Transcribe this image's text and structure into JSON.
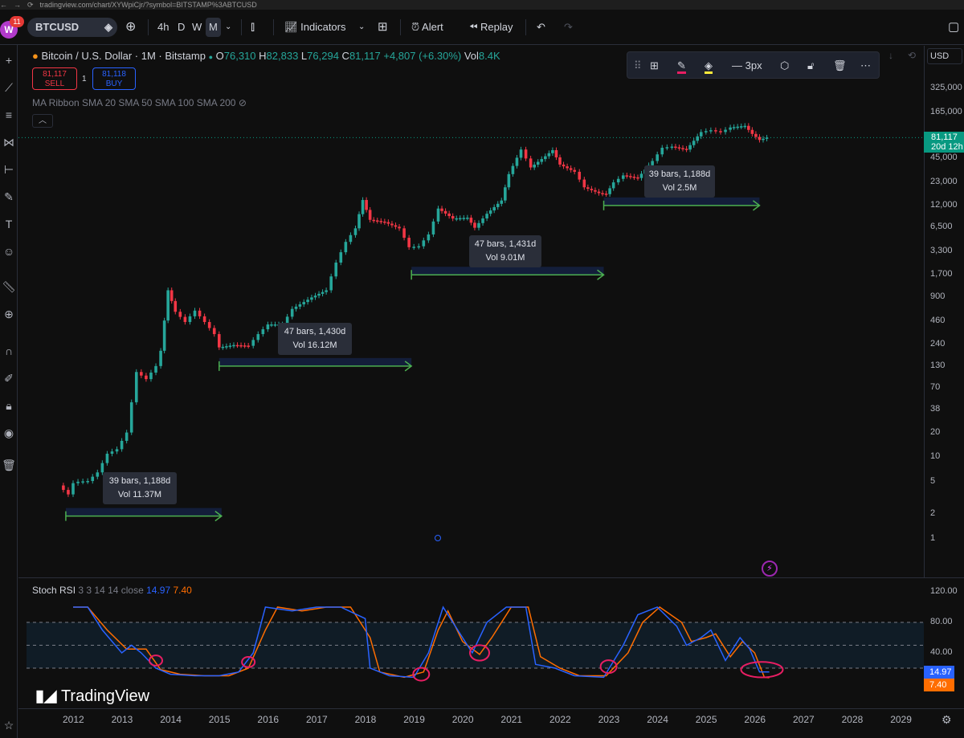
{
  "browser": {
    "url": "tradingview.com/chart/XYWpiCjr/?symbol=BITSTAMP%3ABTCUSD"
  },
  "toolbar": {
    "avatar_letter": "W",
    "notification_count": "11",
    "symbol": "BTCUSD",
    "timeframes": [
      "4h",
      "D",
      "W",
      "M"
    ],
    "active_timeframe": "M",
    "indicators_label": "Indicators",
    "alert_label": "Alert",
    "replay_label": "Replay"
  },
  "legend": {
    "title": "Bitcoin / U.S. Dollar · 1M · Bitstamp",
    "open_label": "O",
    "open": "76,310",
    "high_label": "H",
    "high": "82,833",
    "low_label": "L",
    "low": "76,294",
    "close_label": "C",
    "close": "81,117",
    "change": "+4,807 (+6.30%)",
    "vol_label": "Vol",
    "vol": "8.4K"
  },
  "trade": {
    "sell_price": "81,117",
    "sell_label": "SELL",
    "qty": "1",
    "buy_price": "81,118",
    "buy_label": "BUY"
  },
  "ma_ribbon_label": "MA Ribbon SMA 20 SMA 50 SMA 100 SMA 200",
  "draw_toolbar": {
    "width_label": "3px"
  },
  "price_axis": {
    "currency": "USD",
    "ticks": [
      "325,000",
      "165,000",
      "45,000",
      "23,000",
      "12,000",
      "6,500",
      "3,300",
      "1,700",
      "900",
      "460",
      "240",
      "130",
      "70",
      "38",
      "20",
      "10",
      "5",
      "2",
      "1"
    ],
    "last_price": "81,117",
    "countdown": "20d 12h"
  },
  "annotations": [
    {
      "bars": "39 bars, 1,188d",
      "vol": "Vol 11.37M"
    },
    {
      "bars": "47 bars, 1,430d",
      "vol": "Vol 16.12M"
    },
    {
      "bars": "47 bars, 1,431d",
      "vol": "Vol 9.01M"
    },
    {
      "bars": "39 bars, 1,188d",
      "vol": "Vol 2.5M"
    }
  ],
  "stoch": {
    "label": "Stoch RSI",
    "params": "3 3 14 14 close",
    "k_value": "14.97",
    "d_value": "7.40",
    "ticks": [
      "120.00",
      "80.00",
      "40.00"
    ],
    "k_color": "#2962ff",
    "d_color": "#ff6d00"
  },
  "time_axis": {
    "ticks": [
      "2012",
      "2013",
      "2014",
      "2015",
      "2016",
      "2017",
      "2018",
      "2019",
      "2020",
      "2021",
      "2022",
      "2023",
      "2024",
      "2025",
      "2026",
      "2027",
      "2028",
      "2029"
    ]
  },
  "brand": "TradingView",
  "chart_data": {
    "type": "candlestick",
    "title": "Bitcoin / U.S. Dollar · 1M · Bitstamp",
    "scale": "log",
    "ylim": [
      1,
      325000
    ],
    "x_start_year": 2012,
    "series": [
      {
        "name": "BTCUSD",
        "close": [
          [
            2011.7,
            4.5
          ],
          [
            2011.9,
            3.5
          ],
          [
            2012.0,
            4.8
          ],
          [
            2012.1,
            5.0
          ],
          [
            2012.3,
            5.1
          ],
          [
            2012.5,
            6.5
          ],
          [
            2012.7,
            11
          ],
          [
            2012.9,
            12.5
          ],
          [
            2013.1,
            20
          ],
          [
            2013.3,
            110
          ],
          [
            2013.5,
            90
          ],
          [
            2013.7,
            130
          ],
          [
            2013.8,
            200
          ],
          [
            2013.95,
            1100
          ],
          [
            2014.1,
            600
          ],
          [
            2014.3,
            450
          ],
          [
            2014.5,
            620
          ],
          [
            2014.7,
            450
          ],
          [
            2014.9,
            320
          ],
          [
            2015.0,
            220
          ],
          [
            2015.3,
            235
          ],
          [
            2015.6,
            230
          ],
          [
            2015.8,
            320
          ],
          [
            2016.0,
            420
          ],
          [
            2016.3,
            420
          ],
          [
            2016.5,
            650
          ],
          [
            2016.9,
            900
          ],
          [
            2017.2,
            1100
          ],
          [
            2017.4,
            2400
          ],
          [
            2017.6,
            4300
          ],
          [
            2017.8,
            6300
          ],
          [
            2017.95,
            14000
          ],
          [
            2018.1,
            8000
          ],
          [
            2018.4,
            7500
          ],
          [
            2018.7,
            6300
          ],
          [
            2018.9,
            3700
          ],
          [
            2019.1,
            3800
          ],
          [
            2019.3,
            5300
          ],
          [
            2019.5,
            11000
          ],
          [
            2019.8,
            8300
          ],
          [
            2020.1,
            8500
          ],
          [
            2020.25,
            6400
          ],
          [
            2020.5,
            9500
          ],
          [
            2020.8,
            13800
          ],
          [
            2020.95,
            29000
          ],
          [
            2021.2,
            58000
          ],
          [
            2021.4,
            35000
          ],
          [
            2021.7,
            48000
          ],
          [
            2021.85,
            57000
          ],
          [
            2022.0,
            38000
          ],
          [
            2022.3,
            31000
          ],
          [
            2022.5,
            20000
          ],
          [
            2022.8,
            17000
          ],
          [
            2022.95,
            16500
          ],
          [
            2023.1,
            23000
          ],
          [
            2023.3,
            28000
          ],
          [
            2023.6,
            26000
          ],
          [
            2023.9,
            42000
          ],
          [
            2024.1,
            61000
          ],
          [
            2024.3,
            63000
          ],
          [
            2024.6,
            58000
          ],
          [
            2024.9,
            95000
          ],
          [
            2025.1,
            100000
          ],
          [
            2025.3,
            95000
          ],
          [
            2025.5,
            108000
          ],
          [
            2025.8,
            113000
          ],
          [
            2025.95,
            90000
          ],
          [
            2026.1,
            76000
          ],
          [
            2026.25,
            81117
          ]
        ]
      }
    ],
    "measures": [
      {
        "label": "39 bars, 1,188d",
        "vol": "Vol 11.37M",
        "from": 2011.85,
        "to": 2015.05,
        "price": 1.9
      },
      {
        "label": "47 bars, 1,430d",
        "vol": "Vol 16.12M",
        "from": 2015.0,
        "to": 2018.95,
        "price": 130
      },
      {
        "label": "47 bars, 1,431d",
        "vol": "Vol 9.01M",
        "from": 2018.95,
        "to": 2022.9,
        "price": 1700
      },
      {
        "label": "39 bars, 1,188d",
        "vol": "Vol 2.5M",
        "from": 2022.9,
        "to": 2026.1,
        "price": 12000
      }
    ],
    "stoch_rsi": {
      "ylim": [
        0,
        120
      ],
      "bands": [
        20,
        80
      ],
      "k": [
        [
          2012.0,
          100
        ],
        [
          2012.3,
          100
        ],
        [
          2012.6,
          70
        ],
        [
          2013.0,
          40
        ],
        [
          2013.2,
          50
        ],
        [
          2013.4,
          40
        ],
        [
          2013.7,
          20
        ],
        [
          2014.0,
          12
        ],
        [
          2014.5,
          10
        ],
        [
          2015.0,
          10
        ],
        [
          2015.4,
          15
        ],
        [
          2015.7,
          40
        ],
        [
          2015.95,
          100
        ],
        [
          2016.5,
          95
        ],
        [
          2017.0,
          100
        ],
        [
          2017.5,
          100
        ],
        [
          2018.0,
          85
        ],
        [
          2018.1,
          20
        ],
        [
          2018.5,
          10
        ],
        [
          2019.0,
          8
        ],
        [
          2019.3,
          40
        ],
        [
          2019.6,
          100
        ],
        [
          2019.8,
          80
        ],
        [
          2020.2,
          40
        ],
        [
          2020.5,
          80
        ],
        [
          2020.9,
          100
        ],
        [
          2021.3,
          100
        ],
        [
          2021.5,
          25
        ],
        [
          2021.9,
          20
        ],
        [
          2022.3,
          10
        ],
        [
          2022.9,
          8
        ],
        [
          2023.3,
          50
        ],
        [
          2023.6,
          90
        ],
        [
          2024.0,
          100
        ],
        [
          2024.4,
          75
        ],
        [
          2024.6,
          50
        ],
        [
          2024.9,
          60
        ],
        [
          2025.1,
          70
        ],
        [
          2025.4,
          30
        ],
        [
          2025.7,
          60
        ],
        [
          2025.9,
          45
        ],
        [
          2026.1,
          15
        ],
        [
          2026.3,
          14.97
        ]
      ],
      "d": [
        [
          2012.0,
          100
        ],
        [
          2012.3,
          100
        ],
        [
          2012.7,
          70
        ],
        [
          2013.1,
          45
        ],
        [
          2013.3,
          45
        ],
        [
          2013.5,
          45
        ],
        [
          2013.8,
          18
        ],
        [
          2014.2,
          12
        ],
        [
          2014.7,
          10
        ],
        [
          2015.2,
          10
        ],
        [
          2015.6,
          20
        ],
        [
          2015.95,
          70
        ],
        [
          2016.2,
          100
        ],
        [
          2016.7,
          95
        ],
        [
          2017.2,
          100
        ],
        [
          2017.7,
          100
        ],
        [
          2018.1,
          60
        ],
        [
          2018.3,
          15
        ],
        [
          2018.8,
          8
        ],
        [
          2019.2,
          15
        ],
        [
          2019.5,
          70
        ],
        [
          2019.7,
          95
        ],
        [
          2020.0,
          55
        ],
        [
          2020.35,
          38
        ],
        [
          2020.6,
          60
        ],
        [
          2021.0,
          100
        ],
        [
          2021.35,
          100
        ],
        [
          2021.6,
          35
        ],
        [
          2022.0,
          20
        ],
        [
          2022.4,
          10
        ],
        [
          2022.95,
          10
        ],
        [
          2023.4,
          40
        ],
        [
          2023.7,
          80
        ],
        [
          2024.05,
          100
        ],
        [
          2024.5,
          80
        ],
        [
          2024.7,
          55
        ],
        [
          2025.0,
          60
        ],
        [
          2025.2,
          65
        ],
        [
          2025.5,
          35
        ],
        [
          2025.75,
          55
        ],
        [
          2026.0,
          40
        ],
        [
          2026.2,
          8
        ],
        [
          2026.3,
          7.4
        ]
      ]
    }
  }
}
